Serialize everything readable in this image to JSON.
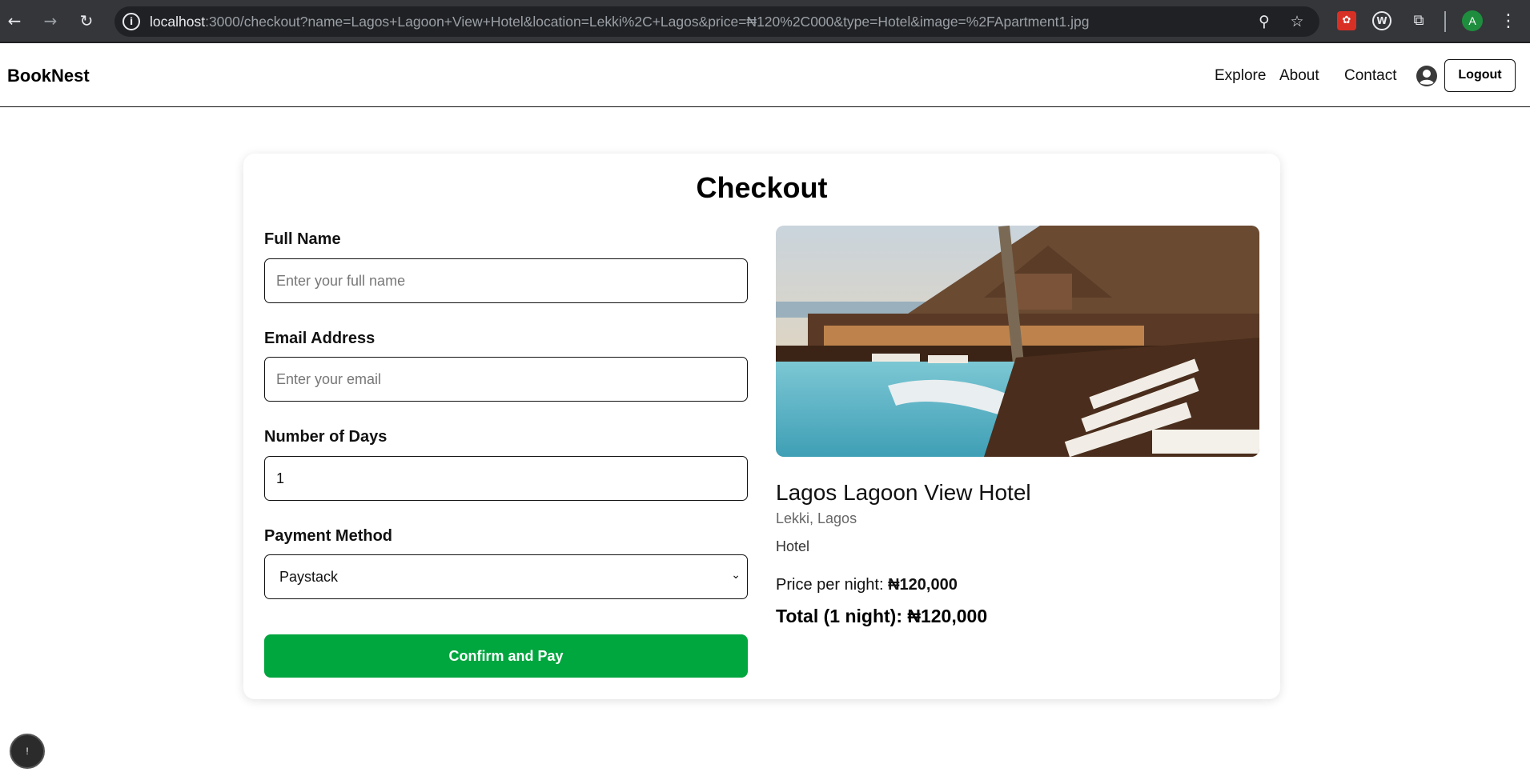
{
  "browser": {
    "url_host": "localhost",
    "url_rest": ":3000/checkout?name=Lagos+Lagoon+View+Hotel&location=Lekki%2C+Lagos&price=₦120%2C000&type=Hotel&image=%2FApartment1.jpg",
    "profile_initial": "A",
    "icons": [
      "back-icon",
      "forward-icon",
      "reload-icon",
      "info-icon",
      "zoom-icon",
      "star-icon",
      "puzzle-icon",
      "menu-icon"
    ]
  },
  "header": {
    "brand": "BookNest",
    "nav": [
      "Explore",
      "About",
      "Contact"
    ],
    "logout": "Logout"
  },
  "checkout": {
    "title": "Checkout",
    "full_name_label": "Full Name",
    "full_name_placeholder": "Enter your full name",
    "email_label": "Email Address",
    "email_placeholder": "Enter your email",
    "days_label": "Number of Days",
    "days_value": "1",
    "payment_label": "Payment Method",
    "payment_value": "Paystack",
    "confirm_button": "Confirm and Pay"
  },
  "listing": {
    "name": "Lagos Lagoon View Hotel",
    "location": "Lekki, Lagos",
    "type": "Hotel",
    "price_label": "Price per night: ",
    "price_value": "₦120,000",
    "total": "Total (1 night): ₦120,000"
  },
  "fab_label": "!",
  "colors": {
    "accent_green": "#00a63e",
    "chrome_bg": "#35363a"
  }
}
